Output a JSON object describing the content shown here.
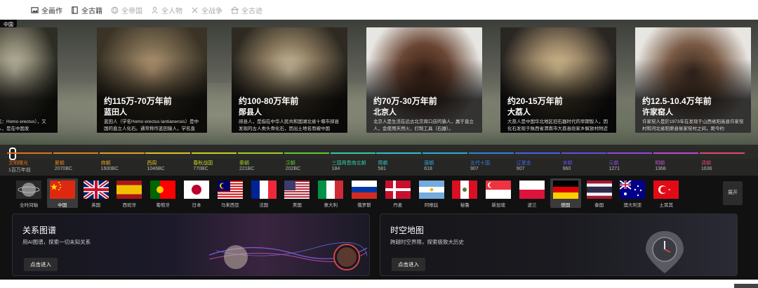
{
  "nav": {
    "tabs": [
      {
        "label": "全画作",
        "icon": "painting-icon",
        "active": true
      },
      {
        "label": "全古籍",
        "icon": "book-icon",
        "active": true
      },
      {
        "label": "全帝国",
        "icon": "globe-icon",
        "active": false
      },
      {
        "label": "全人物",
        "icon": "person-icon",
        "active": false
      },
      {
        "label": "全战争",
        "icon": "swords-icon",
        "active": false
      },
      {
        "label": "全古迹",
        "icon": "building-icon",
        "active": false
      }
    ]
  },
  "region_label": "中国",
  "cards": [
    {
      "period": "年前",
      "name": "",
      "desc": "立人（学名：Homo erectus），又称元谋猿人，是在中国发",
      "colors": [
        "#2e2e26",
        "#8a8672",
        "#c8c2aa"
      ]
    },
    {
      "period": "约115万-70万年前",
      "name": "蓝田人",
      "desc": "蓝田人（学名Homo erectus lantianensis）是中国的直立人化石。通常称作蓝田猿人，学名直",
      "colors": [
        "#3a3326",
        "#7a6a50",
        "#c0a07a"
      ]
    },
    {
      "period": "约100-80万年前",
      "name": "郧县人",
      "desc": "郧县人，是指在中华人民共和国湖北省十堰市郧县发现的古人类头骨化石，因出土地名而被中国",
      "colors": [
        "#2e2a22",
        "#8b7a5e",
        "#d8c9a8"
      ]
    },
    {
      "period": "约70万-30万年前",
      "name": "北京人",
      "desc": "北京人是生活在远古北京周口店的猿人，属于直立人，会使用天然火，打制工具（石器）。",
      "colors": [
        "#e8e6e2",
        "#6a4634",
        "#3a2218"
      ]
    },
    {
      "period": "约20-15万年前",
      "name": "大荔人",
      "desc": "大荔人是中国华北地区旧石器时代的早期智人，因化石发现于陕西省渭南市大荔县段家乡解放村附近的",
      "colors": [
        "#2a2622",
        "#9a8566",
        "#e0c898"
      ]
    },
    {
      "period": "约12.5-10.4万年前",
      "name": "许家窑人",
      "desc": "许家窑人是於1973年在发现于山西省阳高县许家窑村和河北省阳原县侯家窑村之间，距今约",
      "colors": [
        "#e8e6e2",
        "#7a5a44",
        "#3a2a20"
      ]
    }
  ],
  "timeline": [
    {
      "label": "文明曙光",
      "year": "1百万年前",
      "color": "#e07020"
    },
    {
      "label": "夏朝",
      "year": "2070BC",
      "color": "#e08020"
    },
    {
      "label": "商朝",
      "year": "1600BC",
      "color": "#e0a020"
    },
    {
      "label": "西周",
      "year": "1046BC",
      "color": "#e0c020"
    },
    {
      "label": "春秋战国",
      "year": "770BC",
      "color": "#c8d020"
    },
    {
      "label": "秦朝",
      "year": "221BC",
      "color": "#a0d020"
    },
    {
      "label": "汉朝",
      "year": "202BC",
      "color": "#60c830"
    },
    {
      "label": "三国两晋南北朝",
      "year": "184",
      "color": "#30c8a0"
    },
    {
      "label": "隋朝",
      "year": "581",
      "color": "#30c0c8"
    },
    {
      "label": "唐朝",
      "year": "618",
      "color": "#30a8d8"
    },
    {
      "label": "五代十国",
      "year": "907",
      "color": "#3080e0"
    },
    {
      "label": "辽夏金",
      "year": "907",
      "color": "#4860e0"
    },
    {
      "label": "宋朝",
      "year": "960",
      "color": "#6050e0"
    },
    {
      "label": "元朝",
      "year": "1271",
      "color": "#9048e0"
    },
    {
      "label": "明朝",
      "year": "1368",
      "color": "#c048d0"
    },
    {
      "label": "清朝",
      "year": "1636",
      "color": "#e04870"
    }
  ],
  "countries": [
    {
      "label": "全时间轴",
      "flag": "globe"
    },
    {
      "label": "中国",
      "flag": "cn",
      "selected": true
    },
    {
      "label": "英国",
      "flag": "gb"
    },
    {
      "label": "西班牙",
      "flag": "es"
    },
    {
      "label": "葡萄牙",
      "flag": "pt"
    },
    {
      "label": "日本",
      "flag": "jp"
    },
    {
      "label": "马来西亚",
      "flag": "my"
    },
    {
      "label": "法国",
      "flag": "fr"
    },
    {
      "label": "美国",
      "flag": "us"
    },
    {
      "label": "意大利",
      "flag": "it"
    },
    {
      "label": "俄罗斯",
      "flag": "ru"
    },
    {
      "label": "丹麦",
      "flag": "dk"
    },
    {
      "label": "阿根廷",
      "flag": "ar"
    },
    {
      "label": "秘鲁",
      "flag": "pe"
    },
    {
      "label": "新加坡",
      "flag": "sg"
    },
    {
      "label": "波兰",
      "flag": "pl"
    },
    {
      "label": "德国",
      "flag": "de",
      "selected": true
    },
    {
      "label": "泰国",
      "flag": "th"
    },
    {
      "label": "澳大利亚",
      "flag": "au"
    },
    {
      "label": "土耳其",
      "flag": "tr"
    }
  ],
  "expand_label": "展开",
  "panels": [
    {
      "title": "关系图谱",
      "desc": "用AI图谱，探索一切未知关系",
      "button": "点击进入"
    },
    {
      "title": "时空地图",
      "desc": "跨越时空界限，探索极致大历史",
      "button": "点击进入"
    }
  ]
}
